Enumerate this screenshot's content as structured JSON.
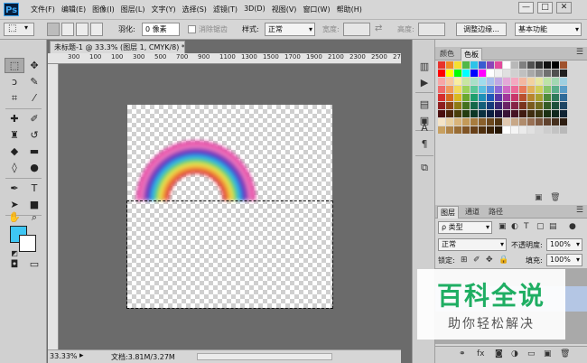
{
  "app": {
    "logo": "Ps",
    "menu": [
      "文件(F)",
      "编辑(E)",
      "图像(I)",
      "图层(L)",
      "文字(Y)",
      "选择(S)",
      "滤镜(T)",
      "3D(D)",
      "视图(V)",
      "窗口(W)",
      "帮助(H)"
    ],
    "window_controls": [
      "—",
      "□",
      "✕"
    ]
  },
  "options": {
    "feather_label": "羽化:",
    "feather_value": "0 像素",
    "antialias_label": "消除锯齿",
    "style_label": "样式:",
    "style_value": "正常",
    "width_label": "宽度:",
    "height_label": "高度:",
    "refine_edge": "调整边缘...",
    "workspace": "基本功能"
  },
  "document": {
    "tab_title": "未标题-1 @ 33.3% (图层 1, CMYK/8) *",
    "ruler_ticks": [
      "300",
      "100",
      "100",
      "300",
      "500",
      "700",
      "900",
      "1100",
      "1300",
      "1500",
      "1700",
      "1900",
      "2100",
      "2300",
      "2500",
      "2700"
    ],
    "zoom": "33.33%",
    "doc_info": "文档:3.81M/3.27M",
    "rainbow_colors": [
      "#e23aa0",
      "#f37ac0",
      "#8b3fb5",
      "#3a4bd0",
      "#2fb3e8",
      "#5ccf6b",
      "#e8e34d",
      "#f19b38",
      "#e23a3a"
    ]
  },
  "swatches_panel": {
    "tabs": [
      "颜色",
      "色板"
    ],
    "menu": "☰",
    "rows": [
      [
        "#e8322c",
        "#f08a24",
        "#f5e030",
        "#52b848",
        "#2ec3e8",
        "#3a5bd1",
        "#8a45b8",
        "#e24a9c",
        "#ffffff",
        "#b8b8b8",
        "#808080",
        "#505050",
        "#303030",
        "#101010",
        "#000000",
        "#a0522d"
      ],
      [
        "#ff0000",
        "#ffff00",
        "#00ff00",
        "#00ffff",
        "#0000ff",
        "#ff00ff",
        "#ffffff",
        "#f0f0f0",
        "#e0e0e0",
        "#d0d0d0",
        "#c0c0c0",
        "#a8a8a8",
        "#909090",
        "#707070",
        "#505050",
        "#202020"
      ],
      [
        "#f7a6a6",
        "#f7c8a0",
        "#f9eea0",
        "#c8e6a0",
        "#a8e0c8",
        "#a0dcec",
        "#a8c0ec",
        "#c0a8e4",
        "#e4a8d8",
        "#f4a8c0",
        "#f3b7a0",
        "#f1d2a0",
        "#e7e7a0",
        "#bde4a6",
        "#a2d8b2",
        "#9ecfe0"
      ],
      [
        "#ef6b6b",
        "#f09a5a",
        "#f2da5a",
        "#9bd25a",
        "#5ac89a",
        "#5ac0e0",
        "#5a8ee0",
        "#8e6ad8",
        "#d06ac4",
        "#ec6a98",
        "#e87a5a",
        "#e2b05a",
        "#cfcf5a",
        "#86c46a",
        "#5aaf8a",
        "#5a9ec8"
      ],
      [
        "#d42e2e",
        "#d76a1e",
        "#d9b81e",
        "#6aa82e",
        "#1e9e6e",
        "#1e90b8",
        "#1e58b8",
        "#5a36a8",
        "#a0369a",
        "#c8366a",
        "#b8502e",
        "#b8862e",
        "#a8a02e",
        "#4e8a3a",
        "#2e7a5a",
        "#2e6a98"
      ],
      [
        "#8e1e1e",
        "#8e4414",
        "#8e7a14",
        "#44721e",
        "#14684a",
        "#145e7a",
        "#143a7a",
        "#3a2472",
        "#6a2466",
        "#862446",
        "#7a341e",
        "#7a5a1e",
        "#706a1e",
        "#345c26",
        "#1e503c",
        "#1e4664"
      ],
      [
        "#4a0e0e",
        "#4a240a",
        "#4a3e0a",
        "#243c10",
        "#0a3626",
        "#0a3040",
        "#0a1e40",
        "#1e123c",
        "#381236",
        "#461224",
        "#401a10",
        "#402e10",
        "#3a3610",
        "#1a3012",
        "#10281e",
        "#102434"
      ],
      [
        "#f4e4c8",
        "#e8cfa0",
        "#d9b47a",
        "#c49a58",
        "#a87c3e",
        "#8a602c",
        "#6c481e",
        "#503412",
        "#e0c8b0",
        "#c8a888",
        "#b08c6c",
        "#987054",
        "#7c5840",
        "#60422e",
        "#46301e",
        "#2e1e12"
      ],
      [
        "#c8a060",
        "#b08448",
        "#986c34",
        "#805424",
        "#684018",
        "#50300e",
        "#3a2208",
        "#261604",
        "#ffffff",
        "#f5f5f5",
        "#ebebeb",
        "#e1e1e1",
        "#d7d7d7",
        "#cdcdcd",
        "#c3c3c3",
        "#b9b9b9"
      ]
    ]
  },
  "layers_panel": {
    "tabs": [
      "图层",
      "通道",
      "路径"
    ],
    "kind_filter": "ρ 类型",
    "blend_mode": "正常",
    "opacity_label": "不透明度:",
    "opacity_value": "100%",
    "lock_label": "锁定:",
    "fill_label": "填充:",
    "fill_value": "100%"
  },
  "watermark": {
    "title": "百科全说",
    "subtitle": "助你轻松解决"
  }
}
